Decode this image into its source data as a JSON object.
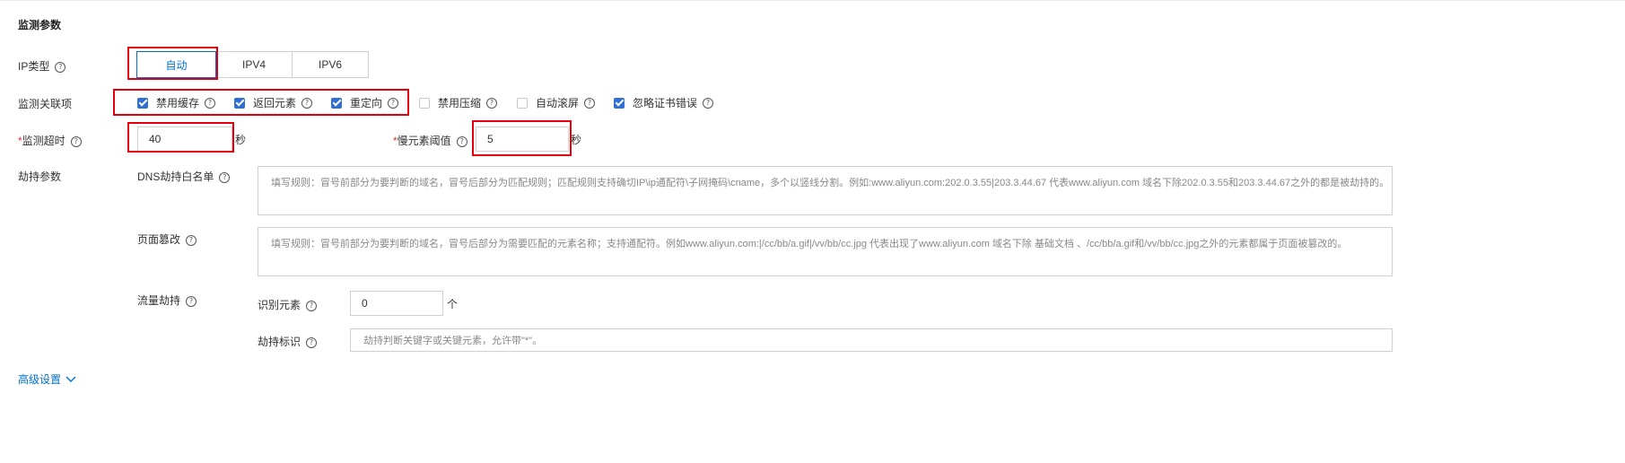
{
  "section_title": "监测参数",
  "ip_type": {
    "label": "IP类型",
    "options": [
      "自动",
      "IPV4",
      "IPV6"
    ],
    "selected": "自动"
  },
  "monitor_items": {
    "label": "监测关联项",
    "options": [
      {
        "label": "禁用缓存",
        "checked": true
      },
      {
        "label": "返回元素",
        "checked": true
      },
      {
        "label": "重定向",
        "checked": true
      },
      {
        "label": "禁用压缩",
        "checked": false
      },
      {
        "label": "自动滚屏",
        "checked": false
      },
      {
        "label": "忽略证书错误",
        "checked": true
      }
    ]
  },
  "timeout": {
    "required_mark": "*",
    "label": "监测超时",
    "value": "40",
    "unit": "秒"
  },
  "slow_threshold": {
    "required_mark": "*",
    "label": "慢元素阈值",
    "value": "5",
    "unit": "秒"
  },
  "hijack": {
    "label": "劫持参数",
    "dns_whitelist": {
      "label": "DNS劫持白名单",
      "placeholder": "填写规则：冒号前部分为要判断的域名，冒号后部分为匹配规则；匹配规则支持确切IP\\ip通配符\\子网掩码\\cname，多个以竖线分割。例如:www.aliyun.com:202.0.3.55|203.3.44.67  代表www.aliyun.com 域名下除202.0.3.55和203.3.44.67之外的都是被劫持的。"
    },
    "page_tamper": {
      "label": "页面篡改",
      "placeholder": "填写规则：冒号前部分为要判断的域名，冒号后部分为需要匹配的元素名称；支持通配符。例如www.aliyun.com:|/cc/bb/a.gif|/vv/bb/cc.jpg 代表出现了www.aliyun.com 域名下除 基础文档 、/cc/bb/a.gif和/vv/bb/cc.jpg之外的元素都属于页面被篡改的。"
    },
    "traffic": {
      "label": "流量劫持",
      "identify_label": "识别元素",
      "identify_value": "0",
      "identify_unit": "个",
      "marker_label": "劫持标识",
      "marker_placeholder": "劫持判断关键字或关键元素，允许带\"*\"。"
    }
  },
  "advanced": {
    "label": "高级设置"
  },
  "help_icon_glyph": "?",
  "colors": {
    "accent": "#0070cc",
    "checkbox": "#2f6fd6",
    "highlight": "#e3000b",
    "required": "#e4393c"
  }
}
